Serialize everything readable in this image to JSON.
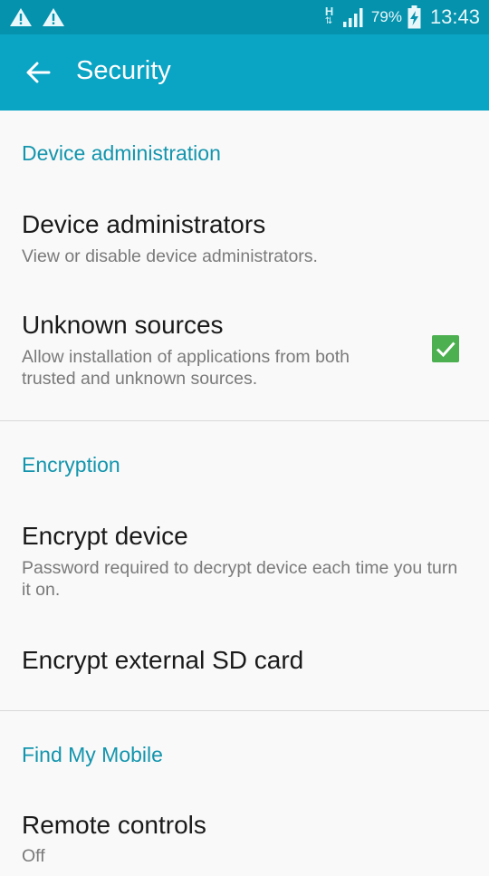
{
  "status_bar": {
    "network_label": "H",
    "battery_percent": "79%",
    "time": "13:43"
  },
  "header": {
    "title": "Security"
  },
  "sections": [
    {
      "header": "Device administration",
      "items": [
        {
          "title": "Device administrators",
          "summary": "View or disable device administrators."
        },
        {
          "title": "Unknown sources",
          "summary": "Allow installation of applications from both trusted and unknown sources.",
          "checked": true
        }
      ]
    },
    {
      "header": "Encryption",
      "items": [
        {
          "title": "Encrypt device",
          "summary": "Password required to decrypt device each time you turn it on."
        },
        {
          "title": "Encrypt external SD card"
        }
      ]
    },
    {
      "header": "Find My Mobile",
      "items": [
        {
          "title": "Remote controls",
          "summary": "Off"
        }
      ]
    }
  ],
  "colors": {
    "status_bar": "#0592ad",
    "app_bar": "#0aa4c4",
    "accent": "#1395ad",
    "checkbox": "#4caf50"
  }
}
